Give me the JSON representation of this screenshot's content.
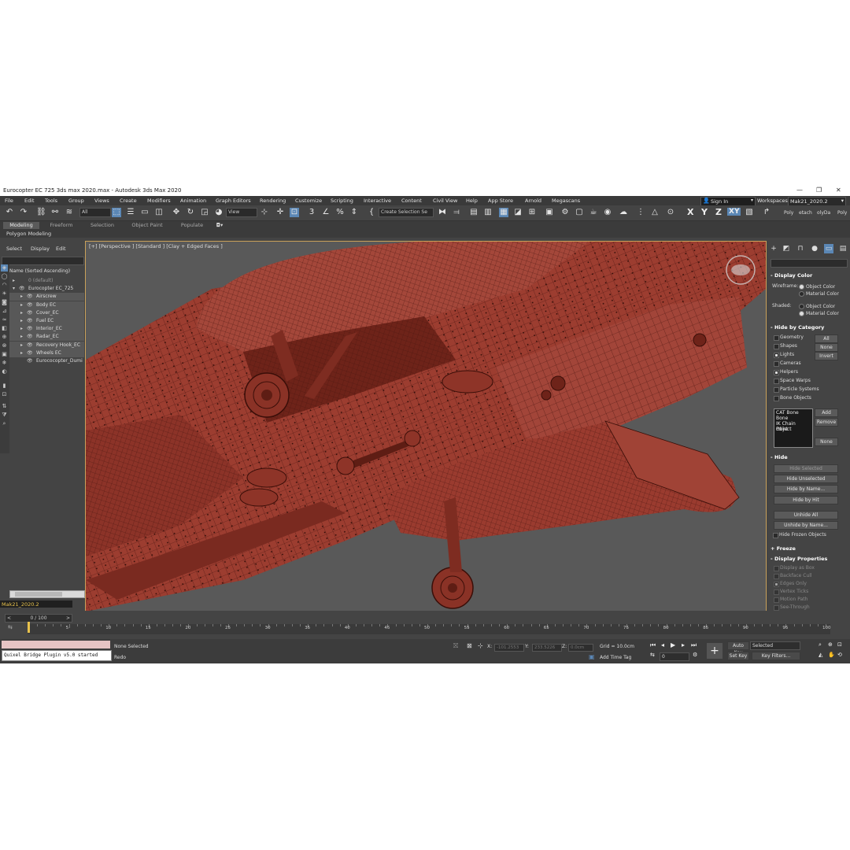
{
  "window": {
    "title": "Eurocopter EC 725 3ds max 2020.max - Autodesk 3ds Max 2020",
    "min": "—",
    "max": "❐",
    "close": "✕"
  },
  "menu": [
    "File",
    "Edit",
    "Tools",
    "Group",
    "Views",
    "Create",
    "Modifiers",
    "Animation",
    "Graph Editors",
    "Rendering",
    "Customize",
    "Scripting",
    "Interactive",
    "Content",
    "Civil View",
    "Help",
    "App Store",
    "Arnold",
    "Megascans"
  ],
  "account": {
    "signin": "Sign In",
    "workspaces_label": "Workspaces:",
    "workspace": "Mak21_2020.2"
  },
  "toolbar": {
    "filter": "All",
    "coord": "View",
    "selset": "Create Selection Se",
    "axes": [
      "X",
      "Y",
      "Z",
      "XY"
    ],
    "poly_tabs": [
      "Poly",
      "etach",
      "olyDa",
      "Poly"
    ]
  },
  "ribbon": {
    "tabs": [
      "Modeling",
      "Freeform",
      "Selection",
      "Object Paint",
      "Populate"
    ],
    "sub": "Polygon Modeling"
  },
  "scene_explorer": {
    "menu": [
      "Select",
      "Display",
      "Edit"
    ],
    "column": "Name (Sorted Ascending)",
    "rows": [
      {
        "name": "0 (default)",
        "level": 1,
        "dim": true,
        "sel": false
      },
      {
        "name": "Eurocopter EC_725",
        "level": 1,
        "dim": false,
        "sel": false
      },
      {
        "name": "Airscrew",
        "level": 2,
        "dim": false,
        "sel": true
      },
      {
        "name": "Body EC",
        "level": 2,
        "dim": false,
        "sel": true
      },
      {
        "name": "Cover_EC",
        "level": 2,
        "dim": false,
        "sel": true
      },
      {
        "name": "Fuel EC",
        "level": 2,
        "dim": false,
        "sel": true
      },
      {
        "name": "Interior_EC",
        "level": 2,
        "dim": false,
        "sel": true
      },
      {
        "name": "Radar_EC",
        "level": 2,
        "dim": false,
        "sel": true
      },
      {
        "name": "Recovery Hook_EC",
        "level": 2,
        "dim": false,
        "sel": true
      },
      {
        "name": "Wheels EC",
        "level": 2,
        "dim": false,
        "sel": true
      },
      {
        "name": "Eurococopter_Dumi",
        "level": 2,
        "dim": false,
        "sel": false
      }
    ],
    "layer": "Mak21_2020.2"
  },
  "viewport": {
    "label": "[+] [Perspective ] [Standard ] [Clay + Edged Faces ]"
  },
  "command_panel": {
    "display_color": {
      "title": "Display Color",
      "wireframe": "Wireframe:",
      "shaded": "Shaded:",
      "object_color": "Object Color",
      "material_color": "Material Color"
    },
    "hide_by_category": {
      "title": "Hide by Category",
      "items": [
        {
          "label": "Geometry",
          "checked": false
        },
        {
          "label": "Shapes",
          "checked": false
        },
        {
          "label": "Lights",
          "checked": true
        },
        {
          "label": "Cameras",
          "checked": false
        },
        {
          "label": "Helpers",
          "checked": true
        },
        {
          "label": "Space Warps",
          "checked": false
        },
        {
          "label": "Particle Systems",
          "checked": false
        },
        {
          "label": "Bone Objects",
          "checked": false
        }
      ],
      "buttons": [
        "All",
        "None",
        "Invert"
      ],
      "list": [
        "CAT Bone",
        "Bone",
        "IK Chain Object",
        "Point"
      ],
      "list_buttons": [
        "Add",
        "Remove",
        "None"
      ]
    },
    "hide": {
      "title": "Hide",
      "buttons": [
        "Hide Selected",
        "Hide Unselected",
        "Hide by Name...",
        "Hide by Hit",
        "Unhide All",
        "Unhide by Name..."
      ],
      "frozen": "Hide Frozen Objects"
    },
    "freeze": {
      "title": "Freeze"
    },
    "display_properties": {
      "title": "Display Properties",
      "items": [
        "Display as Box",
        "Backface Cull",
        "Edges Only",
        "Vertex Ticks",
        "Motion Path",
        "See-Through"
      ]
    }
  },
  "timeline": {
    "slider": "0 / 100",
    "ticks": [
      "0",
      "5",
      "10",
      "15",
      "20",
      "25",
      "30",
      "35",
      "40",
      "45",
      "50",
      "55",
      "60",
      "65",
      "70",
      "75",
      "80",
      "85",
      "90",
      "95",
      "100"
    ]
  },
  "status": {
    "listener": "Quixel Bridge Plugin v5.0 started",
    "selected": "None Selected",
    "prompt": "Redo",
    "x_label": "X:",
    "x": "-101.2553",
    "y_label": "Y:",
    "y": "233.5226",
    "z_label": "Z:",
    "z": "0.0cm",
    "grid": "Grid = 10.0cm",
    "add_time_tag": "Add Time Tag",
    "auto_key": "Auto Key",
    "set_key": "Set Key",
    "key_mode": "Selected",
    "key_filters": "Key Filters...",
    "frame": "0"
  },
  "colors": {
    "accent": "#5b87b5",
    "model": "#9c3d30",
    "viewport_bg": "#5a5a5a",
    "ui_bg": "#444444",
    "highlight": "#e8c24c"
  }
}
